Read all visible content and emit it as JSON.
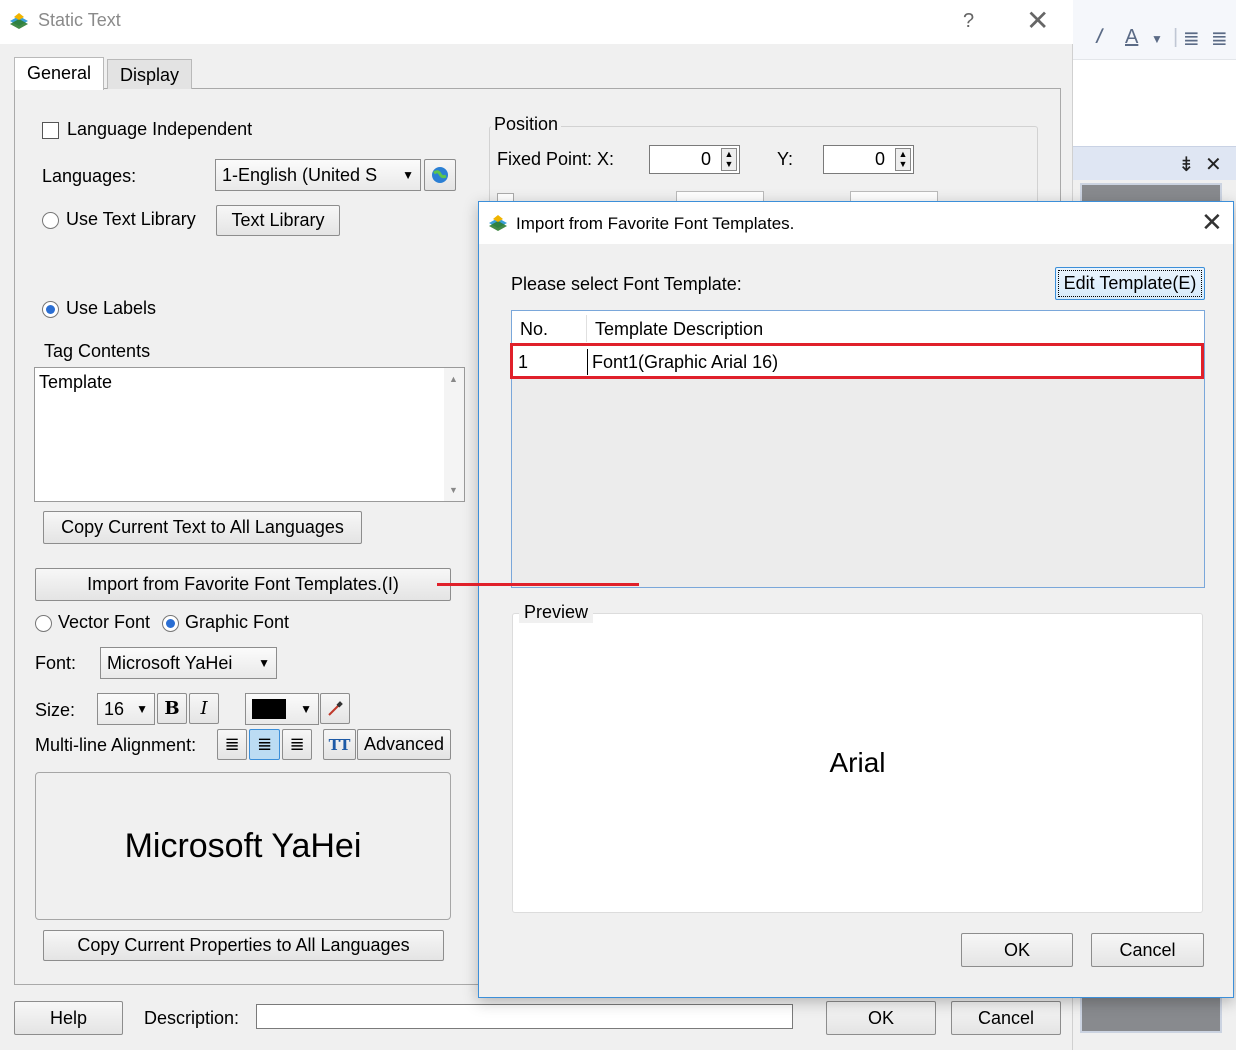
{
  "main_dialog": {
    "title": "Static Text",
    "help_glyph": "?",
    "close_glyph": "✕",
    "tabs": [
      "General",
      "Display"
    ],
    "language_independent_label": "Language Independent",
    "languages_label": "Languages:",
    "languages_value": "1-English (United S",
    "use_text_library_label": "Use Text Library",
    "text_library_button": "Text Library",
    "use_labels_label": "Use Labels",
    "tag_contents_label": "Tag Contents",
    "tag_contents_value": "Template",
    "copy_text_button": "Copy Current Text to All Languages",
    "import_font_button": "Import from Favorite Font Templates.(I)",
    "vector_font_label": "Vector Font",
    "graphic_font_label": "Graphic Font",
    "font_label": "Font:",
    "font_value": "Microsoft YaHei",
    "size_label": "Size:",
    "size_value": "16",
    "bold_glyph": "B",
    "italic_glyph": "I",
    "multiline_label": "Multi-line Alignment:",
    "tt_glyph": "TT",
    "advanced_button": "Advanced",
    "font_preview_text": "Microsoft YaHei",
    "copy_props_button": "Copy Current Properties to All Languages",
    "position_legend": "Position",
    "fixed_point_label": "Fixed Point: X:",
    "x_value": "0",
    "y_label": "Y:",
    "y_value": "0",
    "help_button": "Help",
    "description_label": "Description:",
    "description_value": "",
    "ok_button": "OK",
    "cancel_button": "Cancel",
    "text_color": "#000000"
  },
  "import_dialog": {
    "title": "Import from Favorite Font Templates.",
    "close_glyph": "✕",
    "prompt": "Please select Font Template:",
    "edit_template_button": "Edit Template(E)",
    "columns": [
      "No.",
      "Template Description"
    ],
    "rows": [
      {
        "no": "1",
        "description": "Font1(Graphic Arial 16)"
      }
    ],
    "preview_legend": "Preview",
    "preview_text": "Arial",
    "ok_button": "OK",
    "cancel_button": "Cancel",
    "highlight_color": "#e0202a"
  },
  "background_app": {
    "pin_glyph": "₹",
    "close_glyph": "✕"
  }
}
